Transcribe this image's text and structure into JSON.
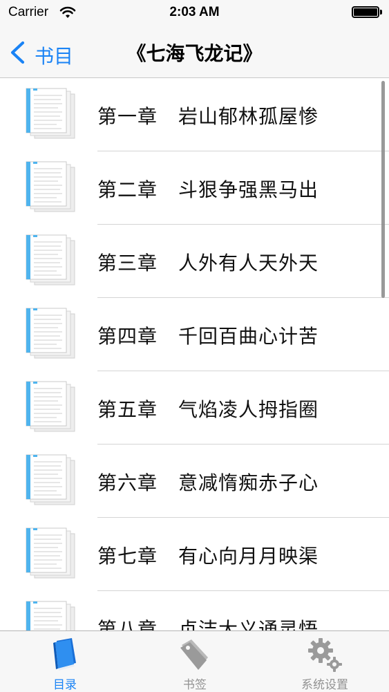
{
  "status_bar": {
    "carrier": "Carrier",
    "time": "2:03 AM",
    "icons": [
      "wifi-icon",
      "battery-icon"
    ]
  },
  "nav": {
    "back_label": "书目",
    "title": "《七海飞龙记》"
  },
  "chapters": [
    {
      "number": "第一章",
      "title": "岩山郁林孤屋惨"
    },
    {
      "number": "第二章",
      "title": "斗狠争强黑马出"
    },
    {
      "number": "第三章",
      "title": "人外有人天外天"
    },
    {
      "number": "第四章",
      "title": "千回百曲心计苦"
    },
    {
      "number": "第五章",
      "title": "气焰凌人拇指圈"
    },
    {
      "number": "第六章",
      "title": "意减惰痴赤子心"
    },
    {
      "number": "第七章",
      "title": "有心向月月映渠"
    },
    {
      "number": "第八章",
      "title": "贞洁大义通灵悟"
    }
  ],
  "tab_bar": {
    "tabs": [
      {
        "label": "目录",
        "icon": "book-icon",
        "selected": true
      },
      {
        "label": "书签",
        "icon": "bookmark-tag-icon",
        "selected": false
      },
      {
        "label": "系统设置",
        "icon": "gear-icon",
        "selected": false
      }
    ]
  },
  "colors": {
    "accent": "#1a83f5",
    "tab_inactive": "#929292",
    "bar_background": "#f7f7f7",
    "separator": "#d4d4d4",
    "icon_stripe": "#4fb4ee"
  }
}
